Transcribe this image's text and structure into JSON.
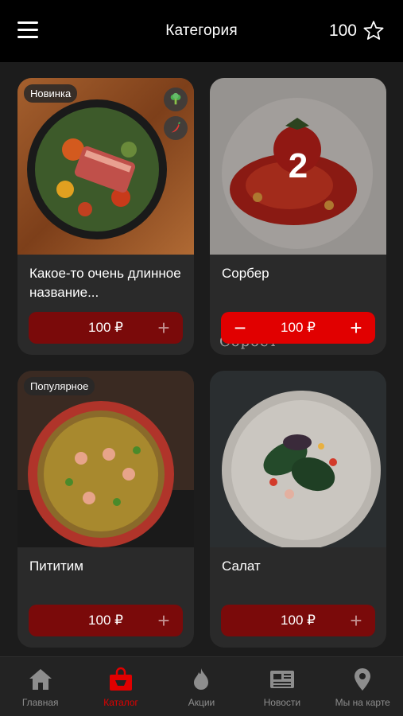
{
  "header": {
    "title": "Категория",
    "points": "100"
  },
  "products": [
    {
      "badge": "Новинка",
      "name": "Какое-то очень длинное название...",
      "price": "100 ₽",
      "quantity": null,
      "tags": [
        "broccoli-icon",
        "chili-pepper-icon"
      ]
    },
    {
      "badge": null,
      "name": "Сорбер",
      "price": "100 ₽",
      "quantity": "2",
      "watermark": "Сорбет",
      "tags": []
    },
    {
      "badge": "Популярное",
      "name": "Пититим",
      "price": "100 ₽",
      "quantity": null,
      "tags": []
    },
    {
      "badge": null,
      "name": "Салат",
      "price": "100 ₽",
      "quantity": null,
      "tags": []
    }
  ],
  "tabbar": {
    "items": [
      {
        "label": "Главная",
        "icon": "home-icon",
        "active": false
      },
      {
        "label": "Каталог",
        "icon": "shopping-bag-icon",
        "active": true
      },
      {
        "label": "Акции",
        "icon": "flame-icon",
        "active": false
      },
      {
        "label": "Новости",
        "icon": "newspaper-icon",
        "active": false
      },
      {
        "label": "Мы на карте",
        "icon": "map-pin-icon",
        "active": false
      }
    ]
  },
  "colors": {
    "accent": "#e10000",
    "button_dark_red": "#7a0a0a",
    "card_bg": "#2a2a2a"
  }
}
